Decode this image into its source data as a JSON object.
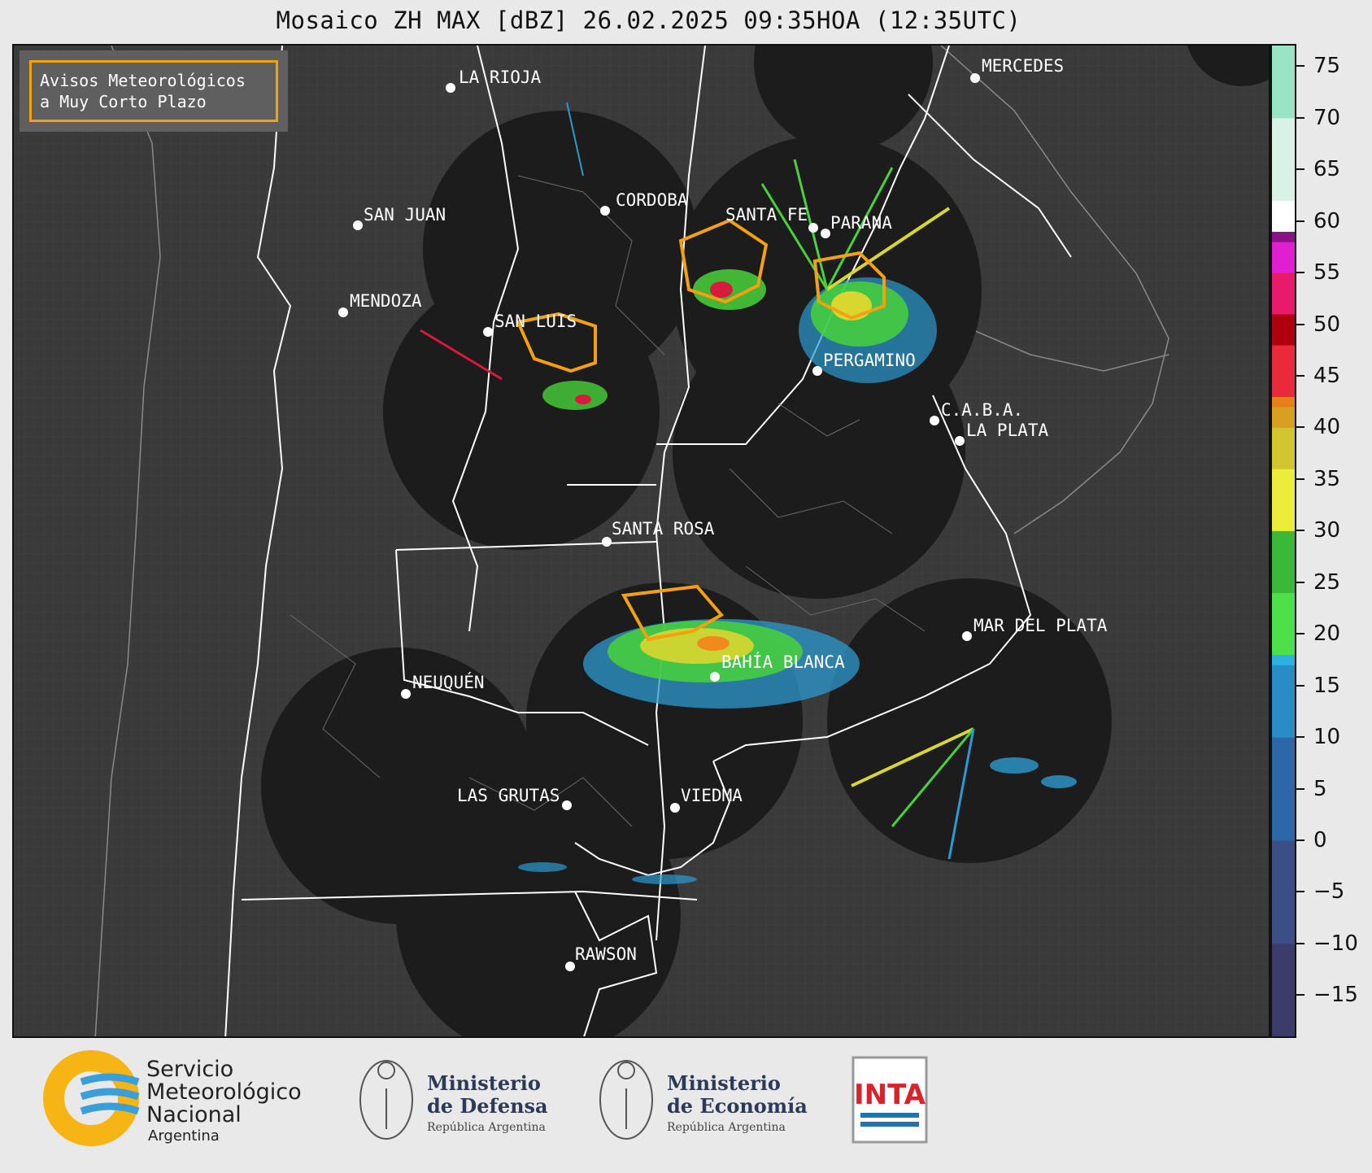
{
  "title": "Mosaico ZH MAX [dBZ] 26.02.2025 09:35HOA (12:35UTC)",
  "warning_box": {
    "line1": "Avisos Meteorológicos",
    "line2": "a Muy Corto Plazo",
    "border_color": "#f5a00f"
  },
  "cities": [
    {
      "name": "LA RIOJA"
    },
    {
      "name": "MERCEDES"
    },
    {
      "name": "CORDOBA"
    },
    {
      "name": "SAN JUAN"
    },
    {
      "name": "SANTA FE"
    },
    {
      "name": "PARANA"
    },
    {
      "name": "MENDOZA"
    },
    {
      "name": "SAN LUIS"
    },
    {
      "name": "PERGAMINO"
    },
    {
      "name": "C.A.B.A."
    },
    {
      "name": "LA PLATA"
    },
    {
      "name": "SANTA ROSA"
    },
    {
      "name": "MAR DEL PLATA"
    },
    {
      "name": "BAHÍA BLANCA"
    },
    {
      "name": "NEUQUÉN"
    },
    {
      "name": "LAS GRUTAS"
    },
    {
      "name": "VIEDMA"
    },
    {
      "name": "RAWSON"
    }
  ],
  "colorbar": {
    "min": -19,
    "max": 77,
    "ticks": [
      "75",
      "70",
      "65",
      "60",
      "55",
      "50",
      "45",
      "40",
      "35",
      "30",
      "25",
      "20",
      "15",
      "10",
      "5",
      "0",
      "−5",
      "−10",
      "−15"
    ],
    "tick_values": [
      75,
      70,
      65,
      60,
      55,
      50,
      45,
      40,
      35,
      30,
      25,
      20,
      15,
      10,
      5,
      0,
      -5,
      -10,
      -15
    ]
  },
  "logos": {
    "smn": {
      "l1": "Servicio",
      "l2": "Meteorológico",
      "l3": "Nacional",
      "l4": "Argentina"
    },
    "defensa": {
      "l1": "Ministerio",
      "l2": "de Defensa",
      "l3": "República Argentina"
    },
    "economia": {
      "l1": "Ministerio",
      "l2": "de Economía",
      "l3": "República Argentina"
    },
    "inta": {
      "l1": "INTA"
    }
  }
}
